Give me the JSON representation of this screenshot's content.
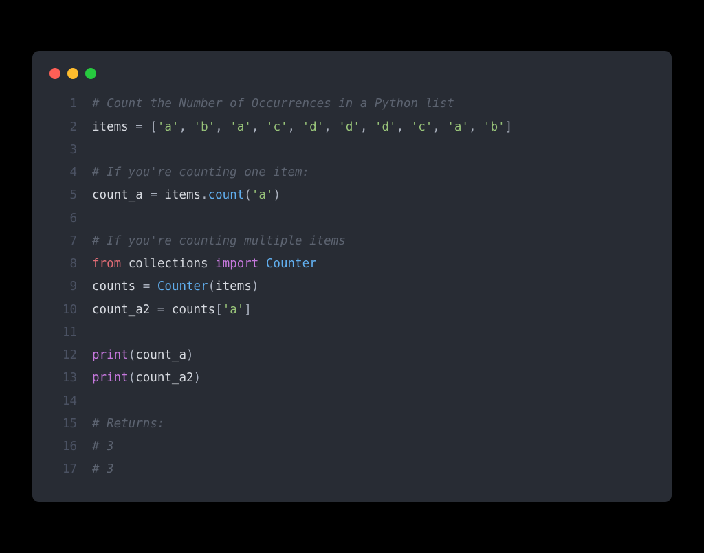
{
  "window": {
    "controls": [
      "close",
      "minimize",
      "maximize"
    ]
  },
  "code": {
    "lines": [
      {
        "num": "1",
        "tokens": [
          {
            "cls": "tok-comment",
            "text": "# Count the Number of Occurrences in a Python list"
          }
        ]
      },
      {
        "num": "2",
        "tokens": [
          {
            "cls": "tok-default",
            "text": "items "
          },
          {
            "cls": "tok-operator",
            "text": "="
          },
          {
            "cls": "tok-default",
            "text": " "
          },
          {
            "cls": "tok-punct",
            "text": "["
          },
          {
            "cls": "tok-string",
            "text": "'a'"
          },
          {
            "cls": "tok-punct",
            "text": ", "
          },
          {
            "cls": "tok-string",
            "text": "'b'"
          },
          {
            "cls": "tok-punct",
            "text": ", "
          },
          {
            "cls": "tok-string",
            "text": "'a'"
          },
          {
            "cls": "tok-punct",
            "text": ", "
          },
          {
            "cls": "tok-string",
            "text": "'c'"
          },
          {
            "cls": "tok-punct",
            "text": ", "
          },
          {
            "cls": "tok-string",
            "text": "'d'"
          },
          {
            "cls": "tok-punct",
            "text": ", "
          },
          {
            "cls": "tok-string",
            "text": "'d'"
          },
          {
            "cls": "tok-punct",
            "text": ", "
          },
          {
            "cls": "tok-string",
            "text": "'d'"
          },
          {
            "cls": "tok-punct",
            "text": ", "
          },
          {
            "cls": "tok-string",
            "text": "'c'"
          },
          {
            "cls": "tok-punct",
            "text": ", "
          },
          {
            "cls": "tok-string",
            "text": "'a'"
          },
          {
            "cls": "tok-punct",
            "text": ", "
          },
          {
            "cls": "tok-string",
            "text": "'b'"
          },
          {
            "cls": "tok-punct",
            "text": "]"
          }
        ]
      },
      {
        "num": "3",
        "tokens": []
      },
      {
        "num": "4",
        "tokens": [
          {
            "cls": "tok-comment",
            "text": "# If you're counting one item:"
          }
        ]
      },
      {
        "num": "5",
        "tokens": [
          {
            "cls": "tok-default",
            "text": "count_a "
          },
          {
            "cls": "tok-operator",
            "text": "="
          },
          {
            "cls": "tok-default",
            "text": " items"
          },
          {
            "cls": "tok-punct",
            "text": "."
          },
          {
            "cls": "tok-funccall",
            "text": "count"
          },
          {
            "cls": "tok-punct",
            "text": "("
          },
          {
            "cls": "tok-string",
            "text": "'a'"
          },
          {
            "cls": "tok-punct",
            "text": ")"
          }
        ]
      },
      {
        "num": "6",
        "tokens": []
      },
      {
        "num": "7",
        "tokens": [
          {
            "cls": "tok-comment",
            "text": "# If you're counting multiple items"
          }
        ]
      },
      {
        "num": "8",
        "tokens": [
          {
            "cls": "tok-from-kw",
            "text": "from"
          },
          {
            "cls": "tok-default",
            "text": " collections "
          },
          {
            "cls": "tok-import-kw",
            "text": "import"
          },
          {
            "cls": "tok-default",
            "text": " "
          },
          {
            "cls": "tok-class",
            "text": "Counter"
          }
        ]
      },
      {
        "num": "9",
        "tokens": [
          {
            "cls": "tok-default",
            "text": "counts "
          },
          {
            "cls": "tok-operator",
            "text": "="
          },
          {
            "cls": "tok-default",
            "text": " "
          },
          {
            "cls": "tok-class",
            "text": "Counter"
          },
          {
            "cls": "tok-punct",
            "text": "("
          },
          {
            "cls": "tok-default",
            "text": "items"
          },
          {
            "cls": "tok-punct",
            "text": ")"
          }
        ]
      },
      {
        "num": "10",
        "tokens": [
          {
            "cls": "tok-default",
            "text": "count_a2 "
          },
          {
            "cls": "tok-operator",
            "text": "="
          },
          {
            "cls": "tok-default",
            "text": " counts"
          },
          {
            "cls": "tok-punct",
            "text": "["
          },
          {
            "cls": "tok-string",
            "text": "'a'"
          },
          {
            "cls": "tok-punct",
            "text": "]"
          }
        ]
      },
      {
        "num": "11",
        "tokens": []
      },
      {
        "num": "12",
        "tokens": [
          {
            "cls": "tok-builtin",
            "text": "print"
          },
          {
            "cls": "tok-punct",
            "text": "("
          },
          {
            "cls": "tok-default",
            "text": "count_a"
          },
          {
            "cls": "tok-punct",
            "text": ")"
          }
        ]
      },
      {
        "num": "13",
        "tokens": [
          {
            "cls": "tok-builtin",
            "text": "print"
          },
          {
            "cls": "tok-punct",
            "text": "("
          },
          {
            "cls": "tok-default",
            "text": "count_a2"
          },
          {
            "cls": "tok-punct",
            "text": ")"
          }
        ]
      },
      {
        "num": "14",
        "tokens": []
      },
      {
        "num": "15",
        "tokens": [
          {
            "cls": "tok-comment",
            "text": "# Returns:"
          }
        ]
      },
      {
        "num": "16",
        "tokens": [
          {
            "cls": "tok-comment",
            "text": "# 3"
          }
        ]
      },
      {
        "num": "17",
        "tokens": [
          {
            "cls": "tok-comment",
            "text": "# 3"
          }
        ]
      }
    ]
  }
}
